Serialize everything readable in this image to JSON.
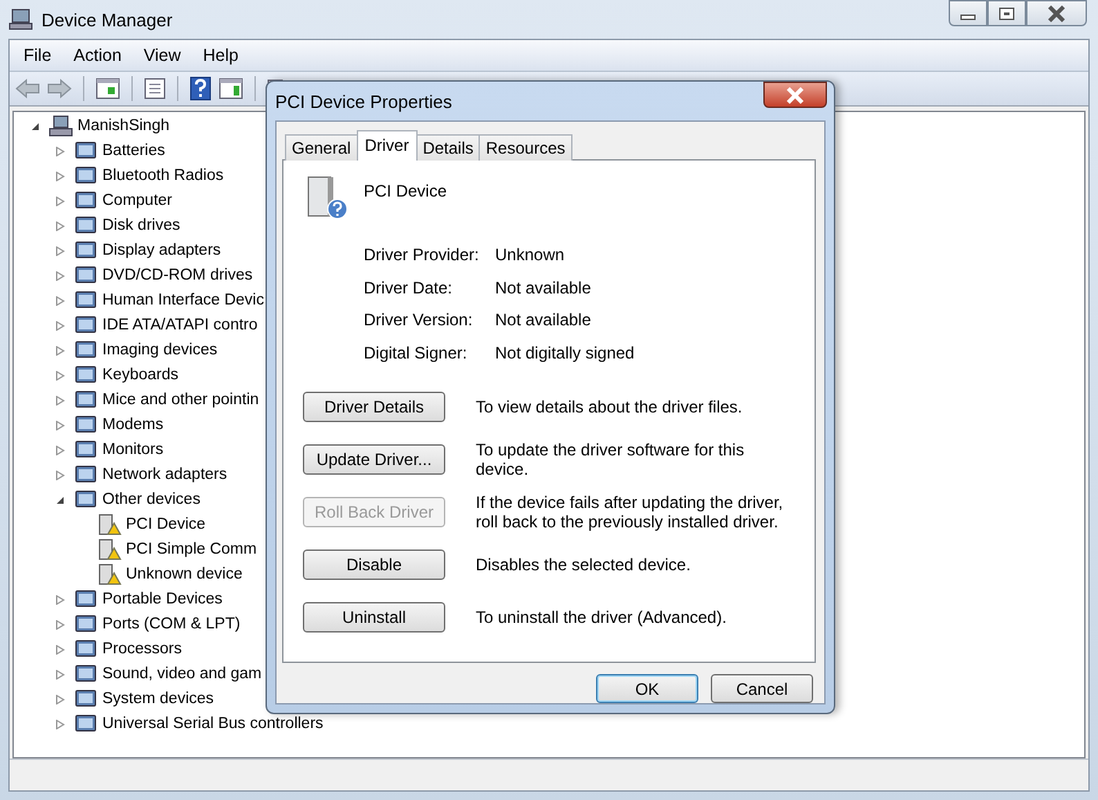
{
  "window": {
    "title": "Device Manager"
  },
  "menu": [
    "File",
    "Action",
    "View",
    "Help"
  ],
  "tree": {
    "label": "ManishSingh",
    "expanded": true,
    "problem": false,
    "children": [
      {
        "label": "Batteries",
        "expanded": false,
        "problem": false
      },
      {
        "label": "Bluetooth Radios",
        "expanded": false,
        "problem": false
      },
      {
        "label": "Computer",
        "expanded": false,
        "problem": false
      },
      {
        "label": "Disk drives",
        "expanded": false,
        "problem": false
      },
      {
        "label": "Display adapters",
        "expanded": false,
        "problem": false
      },
      {
        "label": "DVD/CD-ROM drives",
        "expanded": false,
        "problem": false
      },
      {
        "label": "Human Interface Devic",
        "expanded": false,
        "problem": false
      },
      {
        "label": "IDE ATA/ATAPI contro",
        "expanded": false,
        "problem": false
      },
      {
        "label": "Imaging devices",
        "expanded": false,
        "problem": false
      },
      {
        "label": "Keyboards",
        "expanded": false,
        "problem": false
      },
      {
        "label": "Mice and other pointin",
        "expanded": false,
        "problem": false
      },
      {
        "label": "Modems",
        "expanded": false,
        "problem": false
      },
      {
        "label": "Monitors",
        "expanded": false,
        "problem": false
      },
      {
        "label": "Network adapters",
        "expanded": false,
        "problem": false
      },
      {
        "label": "Other devices",
        "expanded": true,
        "problem": false,
        "children": [
          {
            "label": "PCI Device",
            "problem": true
          },
          {
            "label": "PCI Simple Comm",
            "problem": true
          },
          {
            "label": "Unknown device",
            "problem": true
          }
        ]
      },
      {
        "label": "Portable Devices",
        "expanded": false,
        "problem": false
      },
      {
        "label": "Ports (COM & LPT)",
        "expanded": false,
        "problem": false
      },
      {
        "label": "Processors",
        "expanded": false,
        "problem": false
      },
      {
        "label": "Sound, video and gam",
        "expanded": false,
        "problem": false
      },
      {
        "label": "System devices",
        "expanded": false,
        "problem": false
      },
      {
        "label": "Universal Serial Bus controllers",
        "expanded": false,
        "problem": false
      }
    ]
  },
  "dialog": {
    "title": "PCI Device Properties",
    "tabs": [
      {
        "label": "General",
        "selected": false
      },
      {
        "label": "Driver",
        "selected": true
      },
      {
        "label": "Details",
        "selected": false
      },
      {
        "label": "Resources",
        "selected": false
      }
    ],
    "device_name": "PCI Device",
    "properties": [
      {
        "label": "Driver Provider:",
        "value": "Unknown"
      },
      {
        "label": "Driver Date:",
        "value": "Not available"
      },
      {
        "label": "Driver Version:",
        "value": "Not available"
      },
      {
        "label": "Digital Signer:",
        "value": "Not digitally signed"
      }
    ],
    "actions": [
      {
        "label": "Driver Details",
        "disabled": false,
        "description": "To view details about the driver files."
      },
      {
        "label": "Update Driver...",
        "disabled": false,
        "description": "To update the driver software for this device."
      },
      {
        "label": "Roll Back Driver",
        "disabled": true,
        "description": "If the device fails after updating the driver, roll back to the previously installed driver."
      },
      {
        "label": "Disable",
        "disabled": false,
        "description": "Disables the selected device."
      },
      {
        "label": "Uninstall",
        "disabled": false,
        "description": "To uninstall the driver (Advanced)."
      }
    ],
    "buttons": [
      {
        "label": "OK",
        "default": true
      },
      {
        "label": "Cancel",
        "default": false
      }
    ]
  }
}
